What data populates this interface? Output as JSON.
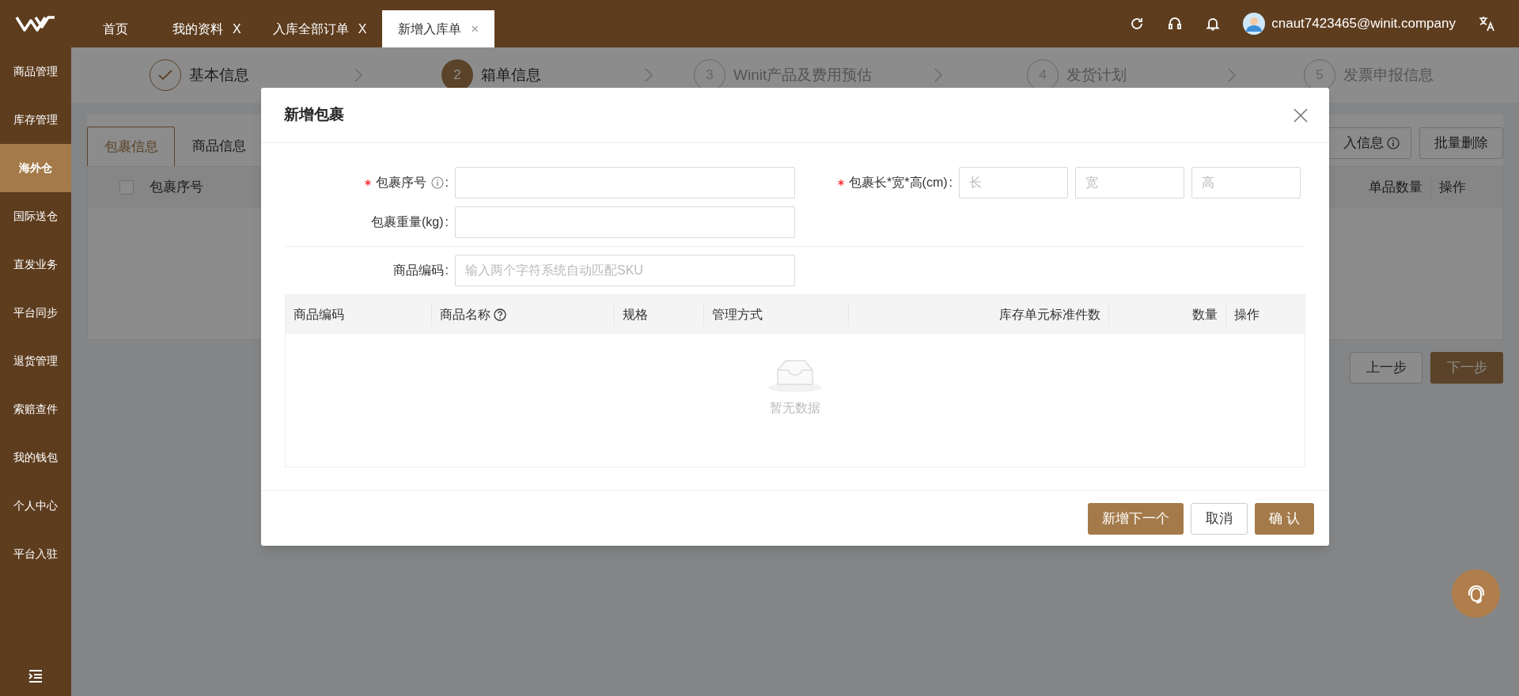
{
  "top_bar": {
    "tabs": [
      {
        "label": "首页",
        "selected": false
      },
      {
        "label": "我的资料",
        "close": "X",
        "selected": false
      },
      {
        "label": "入库全部订单",
        "close": "X",
        "selected": false
      },
      {
        "label": "新增入库单",
        "close": "×",
        "selected": true
      }
    ],
    "user": {
      "email": "cnaut7423465@winit.company"
    }
  },
  "sidebar": {
    "items": [
      {
        "label": "商品管理",
        "selected": false
      },
      {
        "label": "库存管理",
        "selected": false
      },
      {
        "label": "海外仓",
        "selected": true
      },
      {
        "label": "国际送仓",
        "selected": false
      },
      {
        "label": "直发业务",
        "selected": false
      },
      {
        "label": "平台同步",
        "selected": false
      },
      {
        "label": "退货管理",
        "selected": false
      },
      {
        "label": "索赔查件",
        "selected": false
      },
      {
        "label": "我的钱包",
        "selected": false
      },
      {
        "label": "个人中心",
        "selected": false
      },
      {
        "label": "平台入驻",
        "selected": false
      }
    ]
  },
  "steps": [
    {
      "done": true,
      "current": false,
      "label": "基本信息"
    },
    {
      "done": false,
      "current": true,
      "number": "2",
      "label": "箱单信息"
    },
    {
      "done": false,
      "current": false,
      "number": "3",
      "label": "Winit产品及费用预估"
    },
    {
      "done": false,
      "current": false,
      "number": "4",
      "label": "发货计划"
    },
    {
      "done": false,
      "current": false,
      "number": "5",
      "label": "发票申报信息"
    }
  ],
  "page": {
    "tabs": [
      {
        "label": "包裹信息",
        "selected": true
      },
      {
        "label": "商品信息",
        "selected": false
      }
    ],
    "buttons": [
      {
        "label": "入信息",
        "kind": "info"
      },
      {
        "label": "批量删除",
        "kind": "plain"
      }
    ],
    "table": {
      "select_all": {
        "checked": false
      },
      "columns": [
        "包裹序号",
        "单品数量",
        "操作"
      ]
    },
    "nav_buttons": [
      {
        "label": "上一步",
        "primary": false
      },
      {
        "label": "下一步",
        "primary": true
      }
    ]
  },
  "dialog": {
    "title": "新增包裹",
    "fields": [
      {
        "label": "包裹序号",
        "required": true,
        "info": true,
        "colon": ":"
      },
      {
        "label": "包裹重量(kg)",
        "required": false,
        "info": false,
        "colon": ":"
      }
    ],
    "size": {
      "label": "包裹长*宽*高(cm)",
      "required": true,
      "colon": ":",
      "placeholders": [
        "长",
        "宽",
        "高"
      ]
    },
    "sku": {
      "label": "商品编码",
      "colon": ":",
      "placeholder": "输入两个字符系统自动匹配SKU"
    },
    "table": {
      "columns": [
        {
          "label": "商品编码",
          "help": false,
          "right_aligned": false
        },
        {
          "label": "商品名称",
          "help": true,
          "right_aligned": false
        },
        {
          "label": "规格",
          "help": false,
          "right_aligned": false
        },
        {
          "label": "管理方式",
          "help": false,
          "right_aligned": false
        },
        {
          "label": "库存单元标准件数",
          "help": false,
          "right_aligned": true
        },
        {
          "label": "数量",
          "help": false,
          "right_aligned": true
        },
        {
          "label": "操作",
          "help": false,
          "right_aligned": false
        }
      ],
      "empty_text": "暂无数据"
    },
    "buttons": [
      {
        "label": "新增下一个",
        "primary": true
      },
      {
        "label": "取消",
        "primary": false
      },
      {
        "label": "确 认",
        "primary": true
      }
    ]
  }
}
